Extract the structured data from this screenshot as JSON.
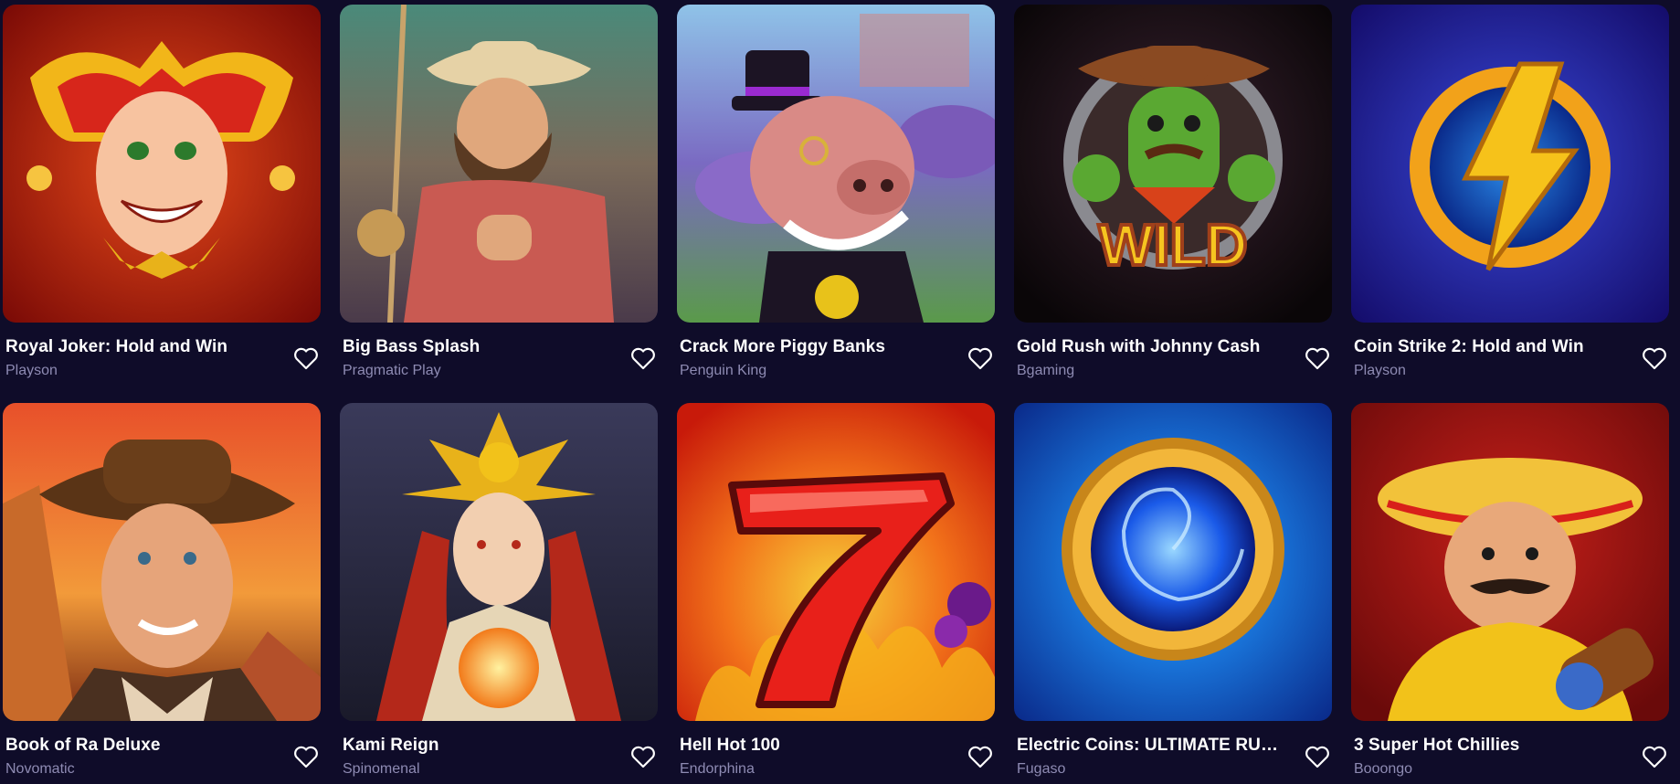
{
  "games": [
    {
      "title": "Royal Joker: Hold and Win",
      "provider": "Playson",
      "art": "joker-art"
    },
    {
      "title": "Big Bass Splash",
      "provider": "Pragmatic Play",
      "art": "fisherman-art"
    },
    {
      "title": "Crack More Piggy Banks",
      "provider": "Penguin King",
      "art": "pig-art"
    },
    {
      "title": "Gold Rush with Johnny Cash",
      "provider": "Bgaming",
      "art": "cactus-wild-art"
    },
    {
      "title": "Coin Strike 2: Hold and Win",
      "provider": "Playson",
      "art": "lightning-coin-art"
    },
    {
      "title": "Book of Ra Deluxe",
      "provider": "Novomatic",
      "art": "explorer-art"
    },
    {
      "title": "Kami Reign",
      "provider": "Spinomenal",
      "art": "goddess-art"
    },
    {
      "title": "Hell Hot 100",
      "provider": "Endorphina",
      "art": "seven-art"
    },
    {
      "title": "Electric Coins: ULTIMATE RUNNING WINS",
      "provider": "Fugaso",
      "art": "vortex-coin-art"
    },
    {
      "title": "3 Super Hot Chillies",
      "provider": "Booongo",
      "art": "mariachi-art"
    }
  ],
  "wild_label": "WILD",
  "colors": {
    "background": "#0f0c29",
    "title": "#ffffff",
    "provider": "#8e8bb3",
    "heart": "#ffffff"
  }
}
